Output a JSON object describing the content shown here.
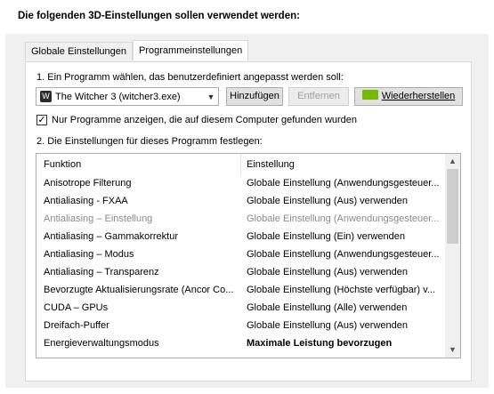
{
  "header": "Die folgenden 3D-Einstellungen sollen verwendet werden:",
  "tabs": [
    {
      "label": "Globale Einstellungen",
      "active": false
    },
    {
      "label": "Programmeinstellungen",
      "active": true
    }
  ],
  "step1_label": "1. Ein Programm wählen, das benutzerdefiniert angepasst werden soll:",
  "program_select": {
    "value": "The Witcher 3 (witcher3.exe)",
    "icon": "witcher-game-icon"
  },
  "buttons": {
    "add": "Hinzufügen",
    "remove": "Entfernen",
    "restore": "Wiederherstellen"
  },
  "checkbox": {
    "label": "Nur Programme anzeigen, die auf diesem Computer gefunden wurden",
    "checked": true,
    "mark": "✓"
  },
  "step2_label": "2. Die Einstellungen für dieses Programm festlegen:",
  "table": {
    "headers": [
      "Funktion",
      "Einstellung"
    ],
    "rows": [
      {
        "function": "Anisotrope Filterung",
        "setting": "Globale Einstellung (Anwendungsgesteuer...",
        "state": "normal"
      },
      {
        "function": "Antialiasing - FXAA",
        "setting": "Globale Einstellung (Aus) verwenden",
        "state": "normal"
      },
      {
        "function": "Antialiasing – Einstellung",
        "setting": "Globale Einstellung (Anwendungsgesteuer...",
        "state": "dim"
      },
      {
        "function": "Antialiasing – Gammakorrektur",
        "setting": "Globale Einstellung (Ein) verwenden",
        "state": "normal"
      },
      {
        "function": "Antialiasing – Modus",
        "setting": "Globale Einstellung (Anwendungsgesteuer...",
        "state": "normal"
      },
      {
        "function": "Antialiasing – Transparenz",
        "setting": "Globale Einstellung (Aus) verwenden",
        "state": "normal"
      },
      {
        "function": "Bevorzugte Aktualisierungsrate (Ancor Co...",
        "setting": "Globale Einstellung (Höchste verfügbar) v...",
        "state": "normal"
      },
      {
        "function": "CUDA – GPUs",
        "setting": "Globale Einstellung (Alle) verwenden",
        "state": "normal"
      },
      {
        "function": "Dreifach-Puffer",
        "setting": "Globale Einstellung (Aus) verwenden",
        "state": "normal"
      },
      {
        "function": "Energieverwaltungsmodus",
        "setting": "Maximale Leistung bevorzugen",
        "state": "bold"
      }
    ]
  },
  "scroll": {
    "up": "▲",
    "down": "▼"
  },
  "colors": {
    "nvidia_green": "#76b900",
    "panel_bg": "#f0f0f0",
    "dim_text": "#8a8a8a"
  }
}
